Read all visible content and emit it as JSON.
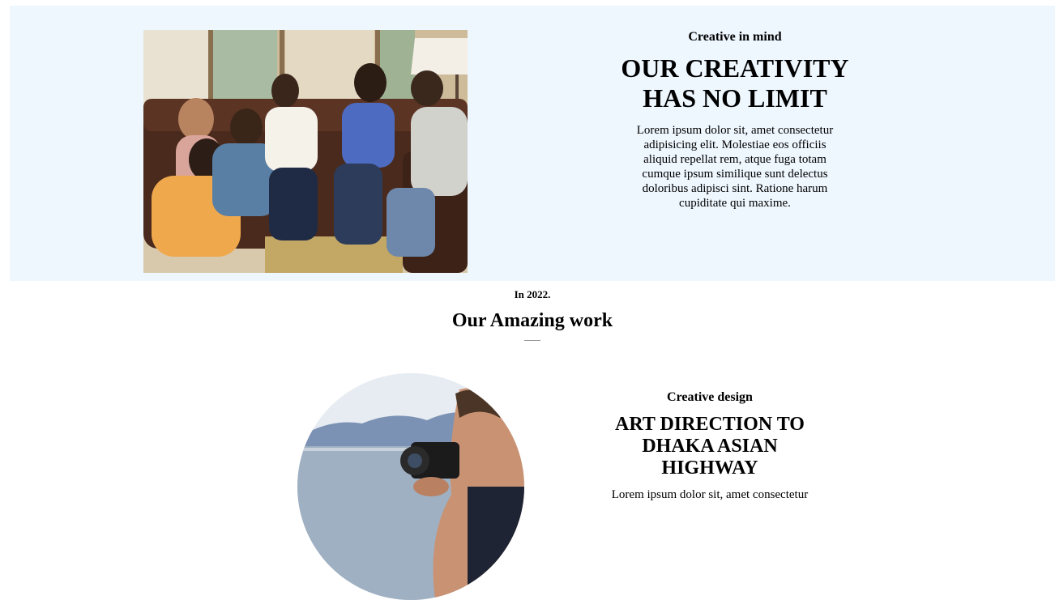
{
  "hero": {
    "eyebrow": "Creative in mind",
    "title": "OUR CREATIVITY HAS NO LIMIT",
    "paragraph": "Lorem ipsum dolor sit, amet consectetur adipisicing elit. Molestiae eos officiis aliquid repellat rem, atque fuga totam cumque ipsum similique sunt delectus doloribus adipisci sint. Ratione harum cupiditate qui maxime."
  },
  "work_section": {
    "eyebrow": "In 2022.",
    "title": "Our Amazing work"
  },
  "work_item": {
    "eyebrow": "Creative design",
    "title": "ART DIRECTION TO DHAKA ASIAN HIGHWAY",
    "paragraph": "Lorem ipsum dolor sit, amet consectetur"
  },
  "colors": {
    "hero_background": "#eef6fe",
    "page_background": "#ffffff",
    "text": "#000000"
  }
}
